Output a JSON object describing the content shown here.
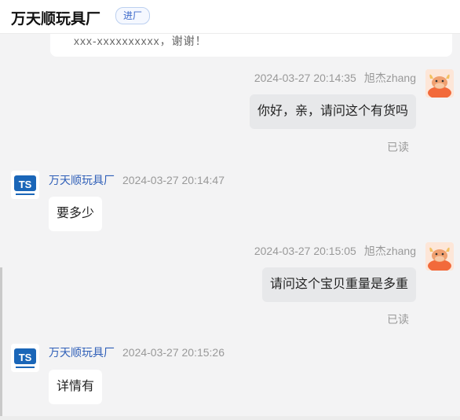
{
  "header": {
    "shop_name": "万天顺玩具厂",
    "tag": "进厂"
  },
  "previous_message": {
    "text": "xxx-xxxxxxxxxx，谢谢！"
  },
  "messages": [
    {
      "side": "right",
      "sender": "旭杰zhang",
      "time": "2024-03-27 20:14:35",
      "text": "你好，亲，请问这个有货吗",
      "status": "已读",
      "avatar": "user-cow-avatar"
    },
    {
      "side": "left",
      "sender": "万天顺玩具厂",
      "time": "2024-03-27 20:14:47",
      "text": "要多少",
      "avatar": "shop-logo-avatar"
    },
    {
      "side": "right",
      "sender": "旭杰zhang",
      "time": "2024-03-27 20:15:05",
      "text": "请问这个宝贝重量是多重",
      "status": "已读",
      "avatar": "user-cow-avatar"
    },
    {
      "side": "left",
      "sender": "万天顺玩具厂",
      "time": "2024-03-27 20:15:26",
      "text": "详情有",
      "avatar": "shop-logo-avatar"
    }
  ],
  "colors": {
    "background": "#f3f3f4",
    "mine_bubble": "#e7e8ea",
    "theirs_bubble": "#ffffff",
    "shop_name_accent": "#2f5fb8",
    "tag_accent": "#3a67c9"
  }
}
